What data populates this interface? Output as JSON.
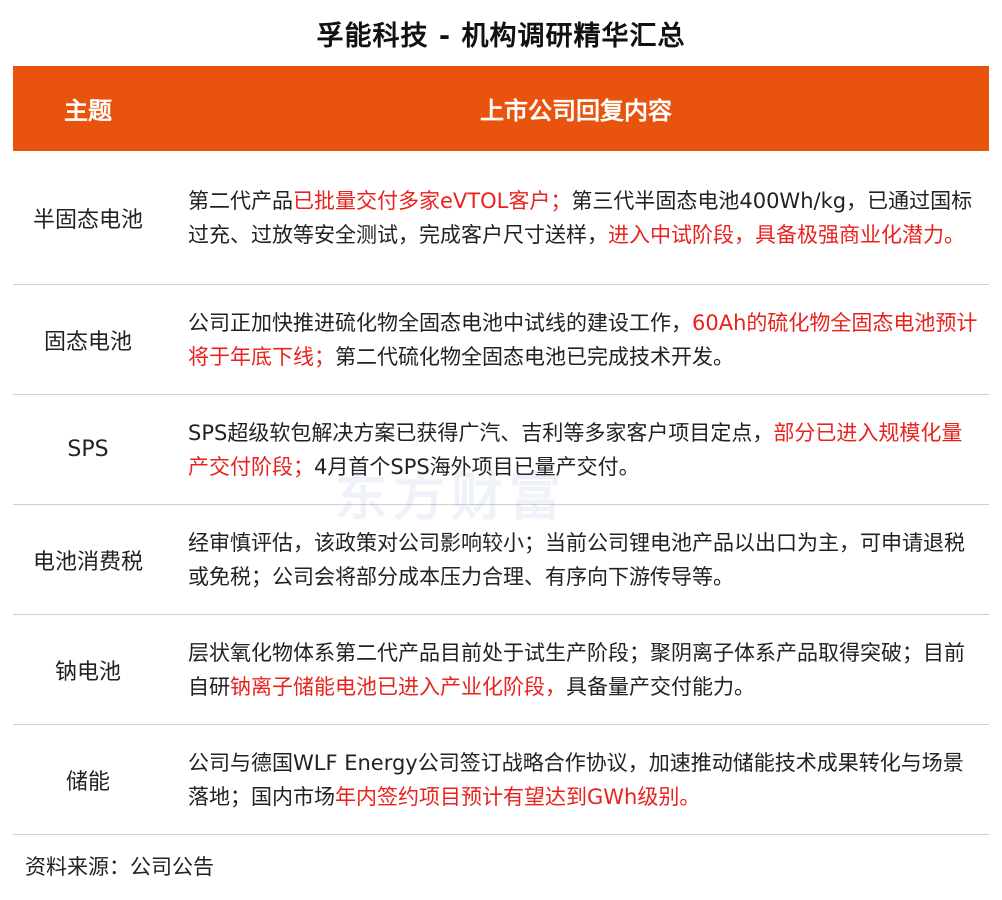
{
  "title": "孚能科技 - 机构调研精华汇总",
  "header": {
    "col1": "主题",
    "col2": "上市公司回复内容"
  },
  "rows": [
    {
      "topic": "半固态电池",
      "segments": [
        {
          "text": "第二代产品",
          "red": false
        },
        {
          "text": "已批量交付多家eVTOL客户；",
          "red": true
        },
        {
          "text": "第三代半固态电池400Wh/kg，已通过国标过充、过放等安全测试，完成客户尺寸送样，",
          "red": false
        },
        {
          "text": "进入中试阶段，具备极强商业化潜力。",
          "red": true
        }
      ]
    },
    {
      "topic": "固态电池",
      "segments": [
        {
          "text": "公司正加快推进硫化物全固态电池中试线的建设工作，",
          "red": false
        },
        {
          "text": "60Ah的硫化物全固态电池预计将于年底下线；",
          "red": true
        },
        {
          "text": "第二代硫化物全固态电池已完成技术开发。",
          "red": false
        }
      ]
    },
    {
      "topic": "SPS",
      "segments": [
        {
          "text": "SPS超级软包解决方案已获得广汽、吉利等多家客户项目定点，",
          "red": false
        },
        {
          "text": "部分已进入规模化量产交付阶段；",
          "red": true
        },
        {
          "text": "4月首个SPS海外项目已量产交付。",
          "red": false
        }
      ]
    },
    {
      "topic": "电池消费税",
      "segments": [
        {
          "text": "经审慎评估，该政策对公司影响较小；当前公司锂电池产品以出口为主，可申请退税或免税；公司会将部分成本压力合理、有序向下游传导等。",
          "red": false
        }
      ]
    },
    {
      "topic": "钠电池",
      "segments": [
        {
          "text": "层状氧化物体系第二代产品目前处于试生产阶段；聚阴离子体系产品取得突破；目前自研",
          "red": false
        },
        {
          "text": "钠离子储能电池已进入产业化阶段，",
          "red": true
        },
        {
          "text": "具备量产交付能力。",
          "red": false
        }
      ]
    },
    {
      "topic": "储能",
      "segments": [
        {
          "text": "公司与德国WLF Energy公司签订战略合作协议，加速推动储能技术成果转化与场景落地；国内市场",
          "red": false
        },
        {
          "text": "年内签约项目预计有望达到GWh级别。",
          "red": true
        }
      ]
    }
  ],
  "source": "资料来源：公司公告",
  "watermark": "东方财富",
  "colors": {
    "header_bg": "#e8540e",
    "highlight": "#e8231e"
  }
}
